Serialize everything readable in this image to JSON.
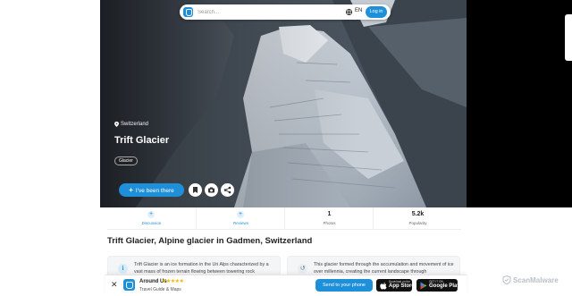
{
  "header": {
    "search_placeholder": "Search...",
    "language": "EN",
    "login_label": "Log in"
  },
  "hero": {
    "location": "Switzerland",
    "title": "Trift Glacier",
    "tag": "Glacier",
    "been_there_label": "I've been there"
  },
  "stats": [
    {
      "value": "+",
      "label": "Discussion"
    },
    {
      "value": "+",
      "label": "Reviews"
    },
    {
      "value": "1",
      "label": "Photos"
    },
    {
      "value": "5.2k",
      "label": "Popularity"
    }
  ],
  "heading": {
    "bold": "Trift Glacier,",
    "rest": " Alpine glacier in Gadmen, Switzerland"
  },
  "cards": [
    {
      "text": "Trift Glacier is an ice formation in the Uri Alps characterized by a vast mass of frozen terrain flowing between towering rock"
    },
    {
      "text": "This glacier formed through the accumulation and movement of ice over millennia, creating the current landscape through"
    }
  ],
  "banner": {
    "app_name": "Around Us",
    "stars": "★★★★★",
    "subtitle": "Travel Guide & Maps",
    "send_label": "Send to your phone",
    "appstore_small": "Download on the",
    "appstore_big": "App Store",
    "googleplay_small": "GET IT ON",
    "googleplay_big": "Google Play"
  },
  "watermark": "ScanMalware",
  "colors": {
    "accent": "#1e8fd9",
    "star": "#f5b301"
  },
  "icons": [
    "logo-icon",
    "globe-icon",
    "pin-icon",
    "bookmark-icon",
    "camera-icon",
    "share-icon",
    "close-icon",
    "apple-icon",
    "play-icon",
    "info-icon",
    "history-icon"
  ]
}
